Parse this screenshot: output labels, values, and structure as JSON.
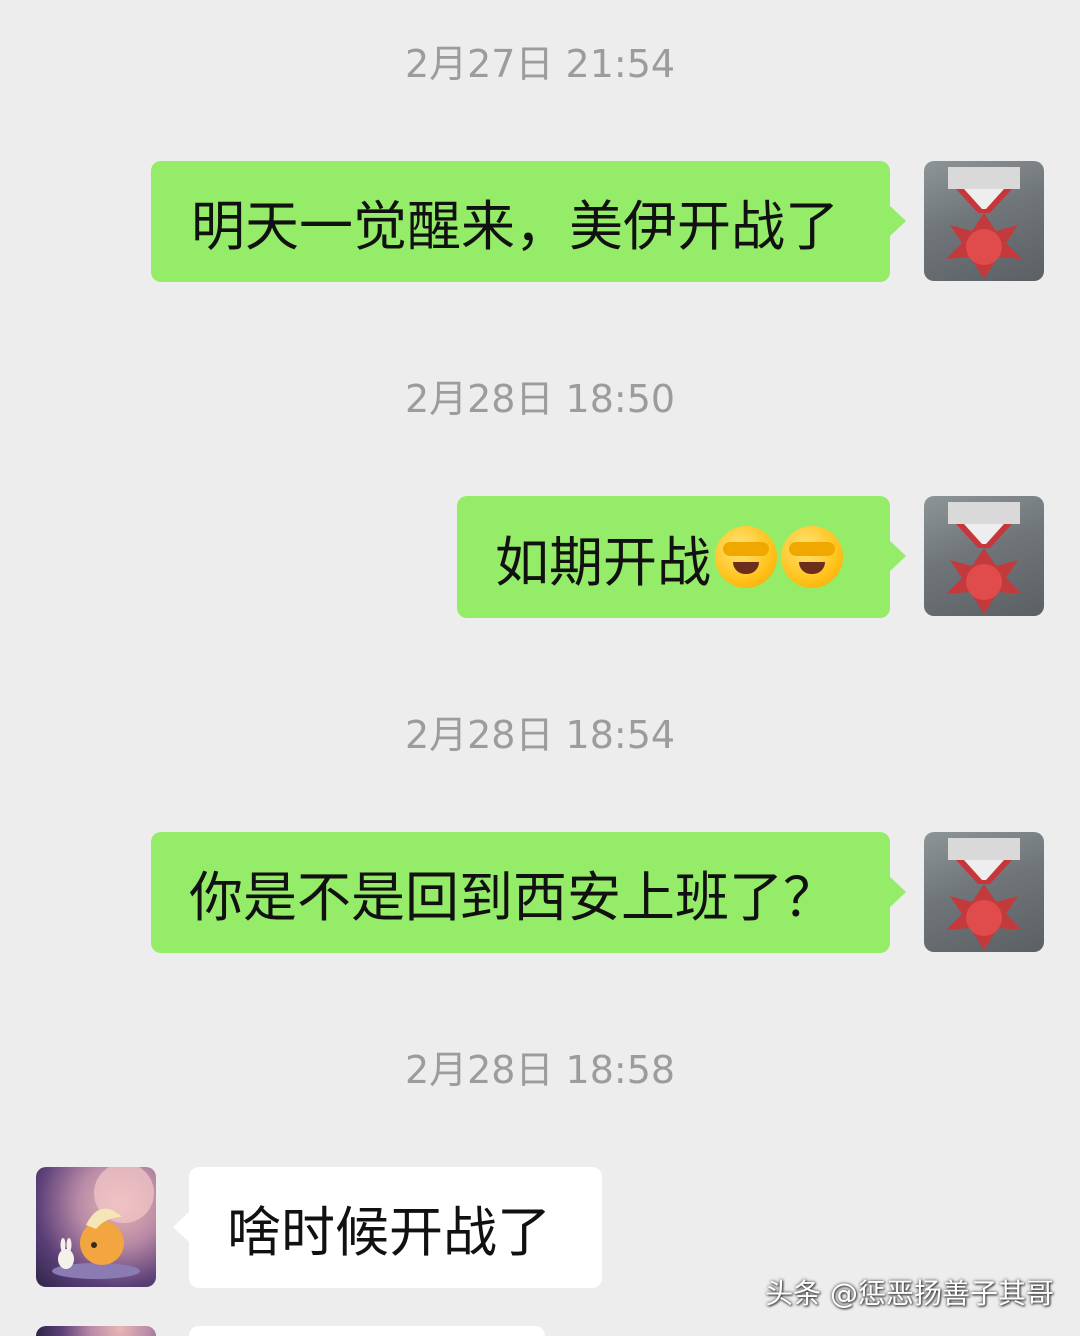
{
  "chat": {
    "messages": [
      {
        "time": "2月27日 21:54",
        "text": "明天一觉醒来，美伊开战了"
      },
      {
        "time": "2月28日 18:50",
        "text": "如期开战"
      },
      {
        "time": "2月28日 18:54",
        "text": "你是不是回到西安上班了？"
      },
      {
        "time": "2月28日 18:58",
        "text": "啥时候开战了"
      }
    ],
    "emoji_names": [
      "face-palm-crying-emoji",
      "face-palm-crying-emoji"
    ]
  },
  "watermark": "头条 @惩恶扬善子其哥",
  "colors": {
    "background": "#ededed",
    "outgoing_bubble": "#95ec69",
    "incoming_bubble": "#ffffff",
    "timestamp": "#9c9c9c"
  }
}
